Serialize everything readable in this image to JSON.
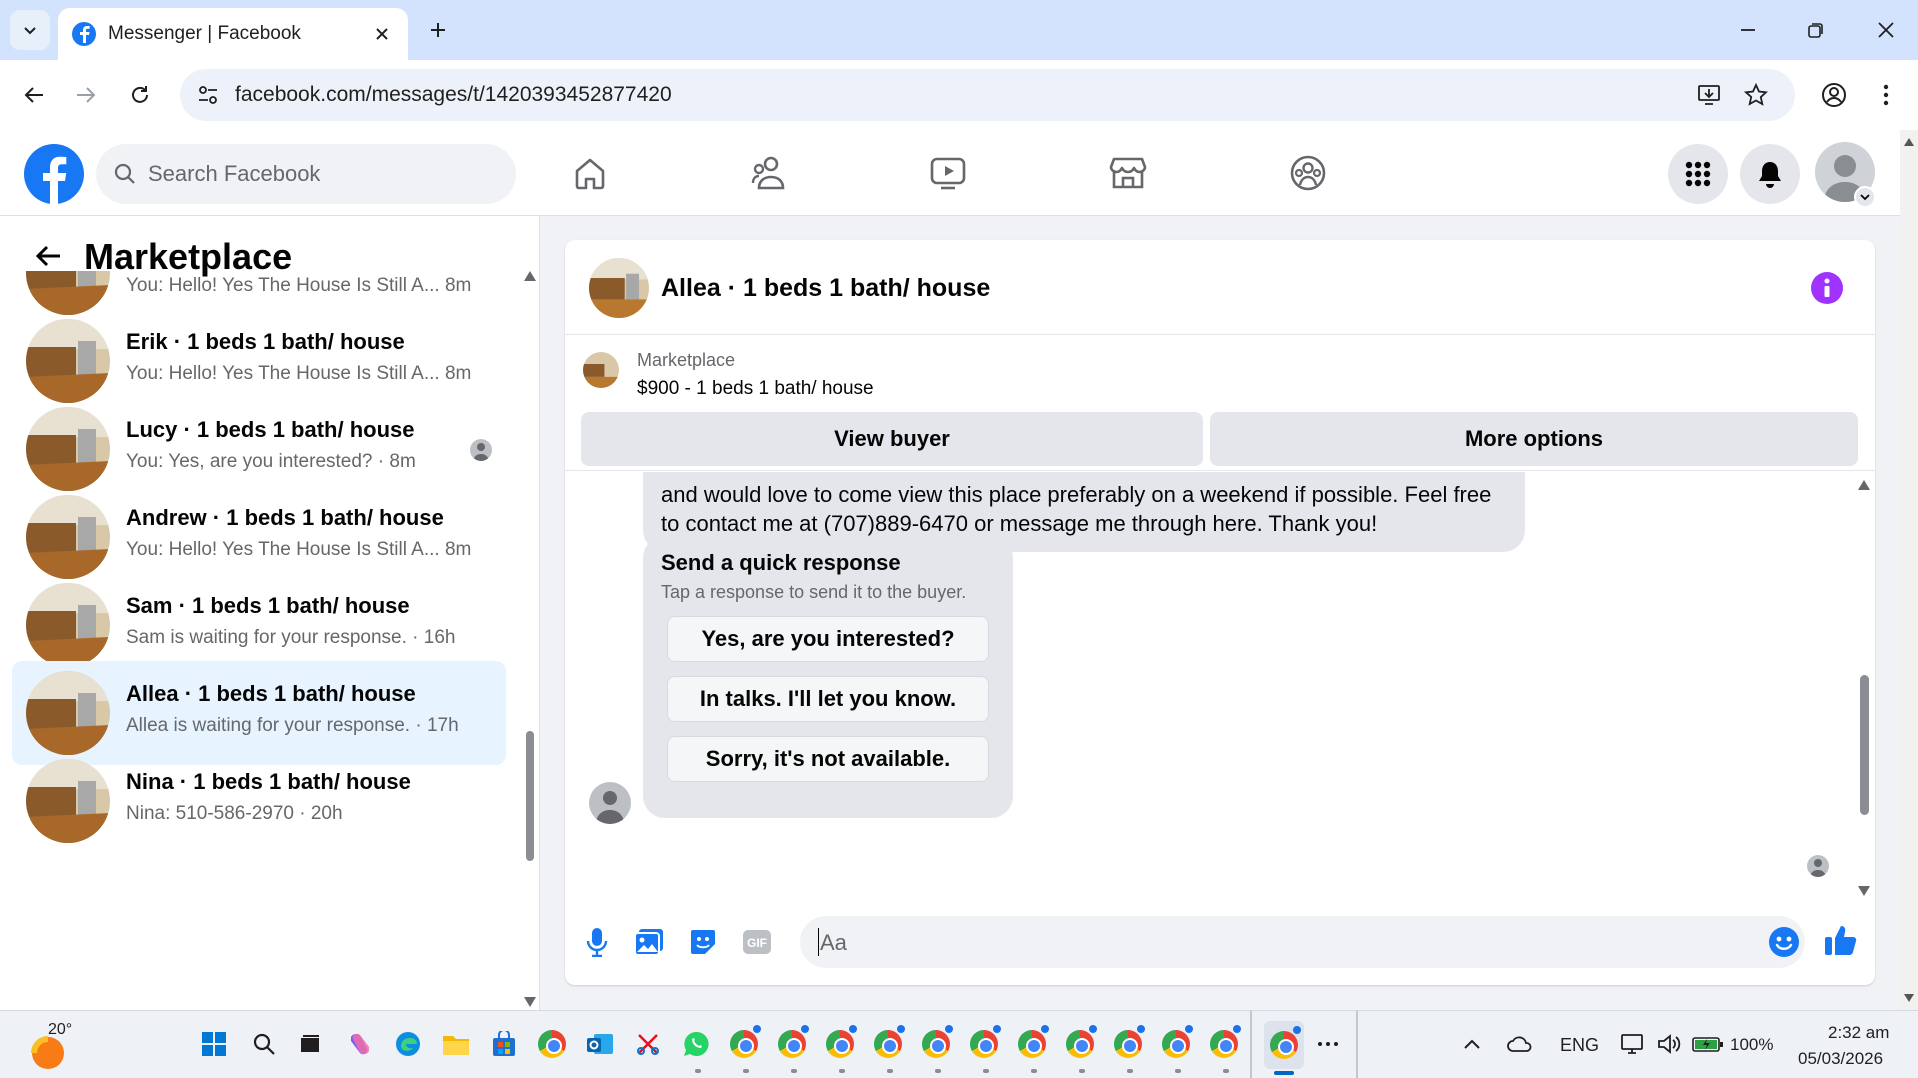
{
  "browser": {
    "tab_title": "Messenger | Facebook",
    "url": "facebook.com/messages/t/1420393452877420"
  },
  "fb": {
    "search_placeholder": "Search Facebook"
  },
  "sidebar": {
    "title": "Marketplace",
    "conversations": [
      {
        "name": "",
        "preview": "You: Hello! Yes The House Is Still A... 8m",
        "active": false
      },
      {
        "name": "Erik · 1 beds 1 bath/ house",
        "preview": "You: Hello! Yes The House Is Still A... 8m",
        "active": false
      },
      {
        "name": "Lucy · 1 beds 1 bath/ house",
        "preview": "You: Yes, are you interested? · 8m",
        "active": false,
        "seen": true
      },
      {
        "name": "Andrew · 1 beds 1 bath/ house",
        "preview": "You: Hello! Yes The House Is Still A... 8m",
        "active": false
      },
      {
        "name": "Sam · 1 beds 1 bath/ house",
        "preview": "Sam is waiting for your response. · 16h",
        "active": false
      },
      {
        "name": "Allea · 1 beds 1 bath/ house",
        "preview": "Allea is waiting for your response. · 17h",
        "active": true
      },
      {
        "name": "Nina · 1 beds 1 bath/ house",
        "preview": "Nina: 510-586-2970 · 20h",
        "active": false
      }
    ]
  },
  "chat": {
    "title": "Allea · 1 beds 1 bath/ house",
    "listing_label": "Marketplace",
    "listing_title": "$900 - 1 beds 1 bath/ house",
    "view_buyer": "View buyer",
    "more_options": "More options",
    "message_line1": "and would love to come view this place preferably on a weekend if possible. Feel free",
    "message_line2": "to contact me at (707)889-6470 or message me through here. Thank you!",
    "quick_response_title": "Send a quick response",
    "quick_response_sub": "Tap a response to send it to the buyer.",
    "quick_responses": [
      "Yes, are you interested?",
      "In talks. I'll let you know.",
      "Sorry, it's not available."
    ],
    "composer_placeholder": "Aa"
  },
  "taskbar": {
    "temperature": "20°",
    "language": "ENG",
    "battery": "100%",
    "time": "2:32 am",
    "date": "05/03/2026"
  },
  "colors": {
    "fb_blue": "#1877f2",
    "info_purple": "#a033ff",
    "active_row": "#e7f3ff"
  }
}
